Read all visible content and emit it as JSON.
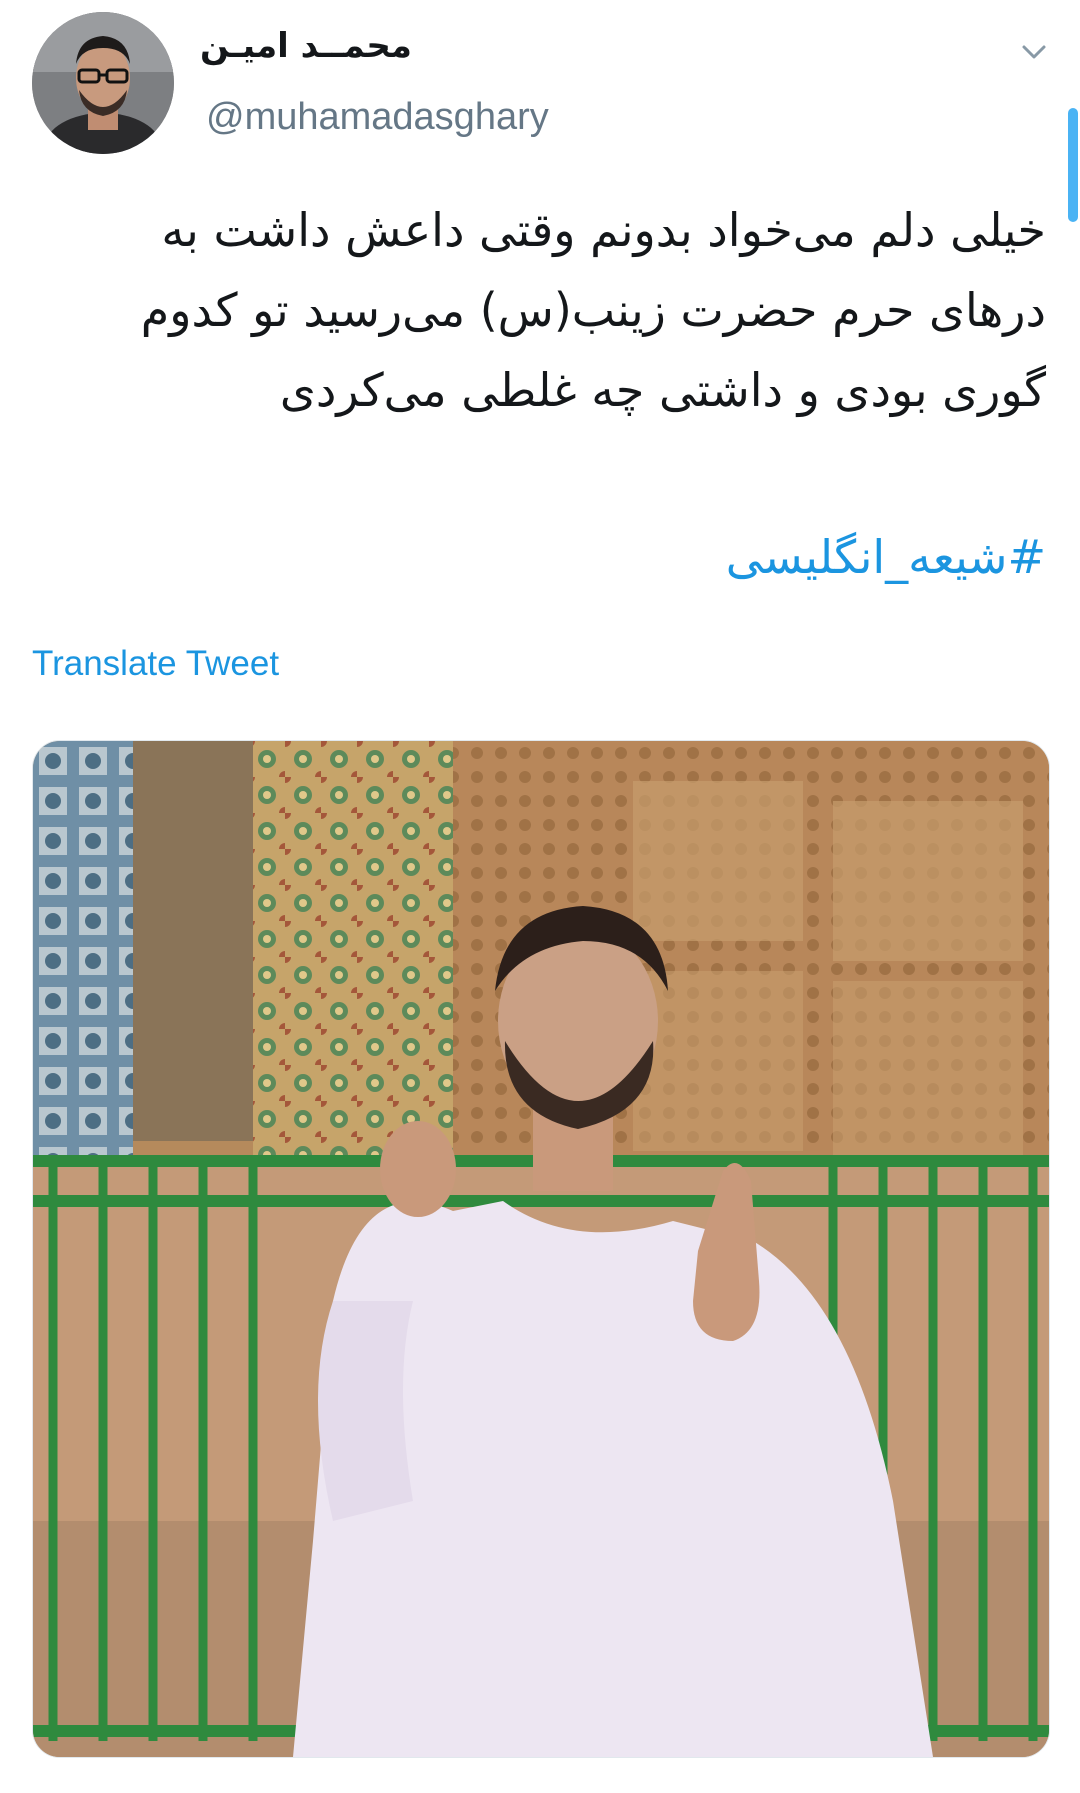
{
  "tweet": {
    "display_name": "محمــد امیـن",
    "handle": "@muhamadasghary",
    "text": "خیلی دلم می‌خواد بدونم وقتی داعش داشت به درهای حرم حضرت زینب(س) می‌رسید تو کدوم گوری بودی و داشتی چه غلطی می‌کردی",
    "hashtag": "#شیعه_انگلیسی",
    "translate_label": "Translate Tweet"
  },
  "icons": {
    "menu": "chevron-down-icon"
  },
  "colors": {
    "link": "#1b95e0",
    "secondary_text": "#657786",
    "primary_text": "#14171a",
    "scroll_indicator": "#4ab3f4"
  }
}
